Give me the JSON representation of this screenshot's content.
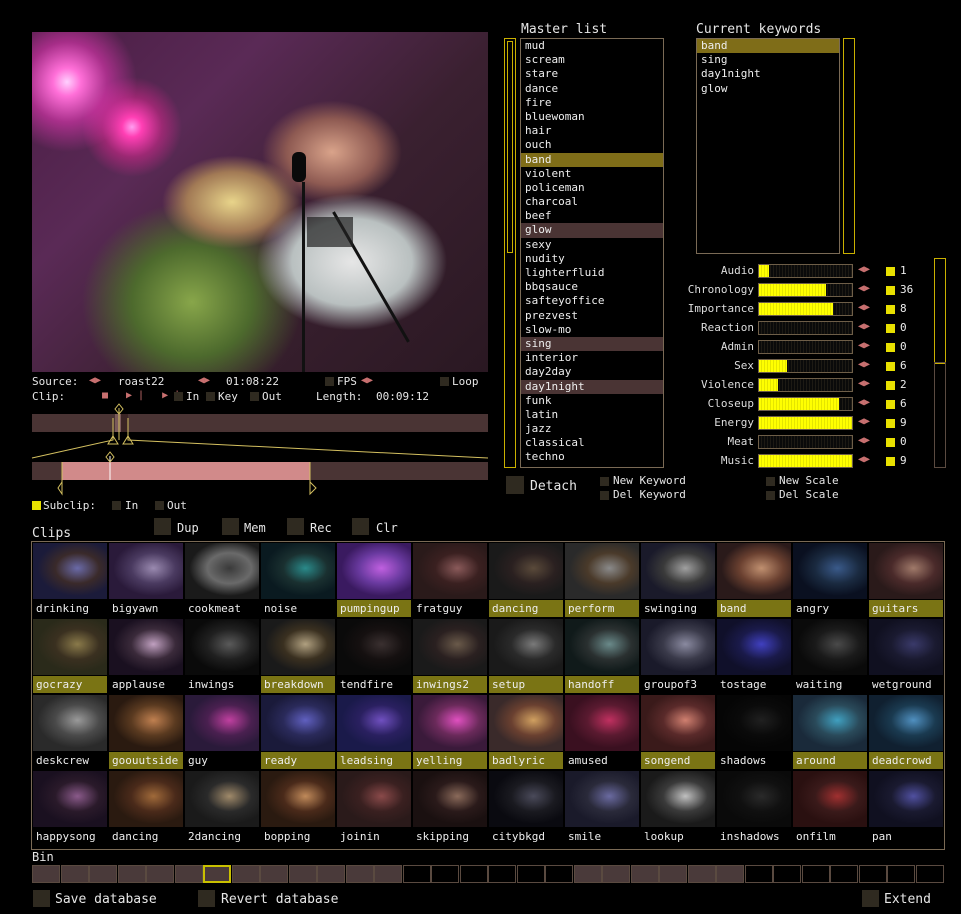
{
  "source": {
    "label": "Source:",
    "name": "roast22",
    "time": "01:08:22",
    "fps": "FPS",
    "loop": "Loop"
  },
  "clip": {
    "label": "Clip:",
    "in": "In",
    "key": "Key",
    "out": "Out",
    "length_label": "Length:",
    "length": "00:09:12"
  },
  "subclip": {
    "label": "Subclip:",
    "in": "In",
    "out": "Out"
  },
  "master": {
    "title": "Master list",
    "items": [
      "mud",
      "scream",
      "stare",
      "dance",
      "fire",
      "bluewoman",
      "hair",
      "ouch",
      "band",
      "violent",
      "policeman",
      "charcoal",
      "beef",
      "glow",
      "sexy",
      "nudity",
      "lighterfluid",
      "bbqsauce",
      "safteyoffice",
      "prezvest",
      "slow-mo",
      "sing",
      "interior",
      "day2day",
      "day1night",
      "funk",
      "latin",
      "jazz",
      "classical",
      "techno"
    ],
    "selected_primary": [
      "band"
    ],
    "selected_secondary": [
      "glow",
      "sing",
      "day1night"
    ]
  },
  "keywords": {
    "title": "Current keywords",
    "items": [
      "band",
      "sing",
      "day1night",
      "glow"
    ],
    "selected": "band"
  },
  "scales": [
    {
      "label": "Audio",
      "value": 1,
      "max": 9
    },
    {
      "label": "Chronology",
      "value": 36,
      "max": 50
    },
    {
      "label": "Importance",
      "value": 8,
      "max": 10
    },
    {
      "label": "Reaction",
      "value": 0,
      "max": 9
    },
    {
      "label": "Admin",
      "value": 0,
      "max": 9
    },
    {
      "label": "Sex",
      "value": 6,
      "max": 20
    },
    {
      "label": "Violence",
      "value": 2,
      "max": 10
    },
    {
      "label": "Closeup",
      "value": 6,
      "max": 7
    },
    {
      "label": "Energy",
      "value": 9,
      "max": 9
    },
    {
      "label": "Meat",
      "value": 0,
      "max": 9
    },
    {
      "label": "Music",
      "value": 9,
      "max": 9
    }
  ],
  "buttons": {
    "detach": "Detach",
    "new_keyword": "New Keyword",
    "del_keyword": "Del Keyword",
    "new_scale": "New Scale",
    "del_scale": "Del Scale",
    "dup": "Dup",
    "mem": "Mem",
    "rec": "Rec",
    "clr": "Clr",
    "save": "Save database",
    "revert": "Revert database",
    "extend": "Extend"
  },
  "clips_title": "Clips",
  "bin_title": "Bin",
  "clips": [
    {
      "name": "drinking",
      "hl": false,
      "c": [
        "#1b1b3a",
        "#6a6aa8",
        "#3a2a2a"
      ]
    },
    {
      "name": "bigyawn",
      "hl": false,
      "c": [
        "#2a1a3a",
        "#9a8ab0",
        "#4a3a60"
      ]
    },
    {
      "name": "cookmeat",
      "hl": false,
      "c": [
        "#1a1a1a",
        "#3a3a3a",
        "#6a6a6a"
      ]
    },
    {
      "name": "noise",
      "hl": false,
      "c": [
        "#0a1a20",
        "#2a8a8a",
        "#1a3030"
      ]
    },
    {
      "name": "pumpingup",
      "hl": true,
      "c": [
        "#3a1a60",
        "#c060e0",
        "#6a3aa0"
      ]
    },
    {
      "name": "fratguy",
      "hl": false,
      "c": [
        "#2a1a1a",
        "#8a5a5a",
        "#3a2020"
      ]
    },
    {
      "name": "dancing",
      "hl": true,
      "c": [
        "#1a1a1a",
        "#5a4a3a",
        "#2a2020"
      ]
    },
    {
      "name": "perform",
      "hl": true,
      "c": [
        "#2a2a2a",
        "#8a8a8a",
        "#4a3a2a"
      ]
    },
    {
      "name": "swinging",
      "hl": false,
      "c": [
        "#1a1a2a",
        "#a0a0a0",
        "#3a3a3a"
      ]
    },
    {
      "name": "band",
      "hl": true,
      "c": [
        "#2a1a1a",
        "#c09070",
        "#6a4030"
      ]
    },
    {
      "name": "angry",
      "hl": false,
      "c": [
        "#0a1020",
        "#3a5a8a",
        "#1a2a40"
      ]
    },
    {
      "name": "guitars",
      "hl": true,
      "c": [
        "#2a1a1a",
        "#a07a6a",
        "#4a2a2a"
      ]
    },
    {
      "name": "gocrazy",
      "hl": true,
      "c": [
        "#2a2a1a",
        "#8a7a4a",
        "#3a3020"
      ]
    },
    {
      "name": "applause",
      "hl": false,
      "c": [
        "#1a1020",
        "#c0a0c0",
        "#3a2a3a"
      ]
    },
    {
      "name": "inwings",
      "hl": false,
      "c": [
        "#0a0a0a",
        "#5a5a5a",
        "#202020"
      ]
    },
    {
      "name": "breakdown",
      "hl": true,
      "c": [
        "#1a1a1a",
        "#b0a080",
        "#3a3020"
      ]
    },
    {
      "name": "tendfire",
      "hl": false,
      "c": [
        "#0a0a0a",
        "#3a3030",
        "#151010"
      ]
    },
    {
      "name": "inwings2",
      "hl": true,
      "c": [
        "#1a1a1a",
        "#6a5a4a",
        "#2a2020"
      ]
    },
    {
      "name": "setup",
      "hl": true,
      "c": [
        "#1a1a1a",
        "#7a7a7a",
        "#2a2a2a"
      ]
    },
    {
      "name": "handoff",
      "hl": true,
      "c": [
        "#101a1a",
        "#6a8a8a",
        "#2a3030"
      ]
    },
    {
      "name": "groupof3",
      "hl": false,
      "c": [
        "#1a1a2a",
        "#8a8aa0",
        "#3a3a4a"
      ]
    },
    {
      "name": "tostage",
      "hl": false,
      "c": [
        "#10102a",
        "#4040c0",
        "#1a1a4a"
      ]
    },
    {
      "name": "waiting",
      "hl": false,
      "c": [
        "#0a0a0a",
        "#4a4a4a",
        "#1a1a1a"
      ]
    },
    {
      "name": "wetground",
      "hl": false,
      "c": [
        "#101020",
        "#3a3a6a",
        "#1a1a30"
      ]
    },
    {
      "name": "deskcrew",
      "hl": false,
      "c": [
        "#2a2a2a",
        "#9a9a9a",
        "#4a4a4a"
      ]
    },
    {
      "name": "goouutside",
      "hl": true,
      "c": [
        "#2a1a10",
        "#c08050",
        "#5a3a20"
      ]
    },
    {
      "name": "guy",
      "hl": false,
      "c": [
        "#2a1a3a",
        "#c040a0",
        "#4a2050"
      ]
    },
    {
      "name": "ready",
      "hl": true,
      "c": [
        "#1a1a3a",
        "#6060c0",
        "#2a2a5a"
      ]
    },
    {
      "name": "leadsing",
      "hl": true,
      "c": [
        "#1a1a4a",
        "#7050c0",
        "#2a2060"
      ]
    },
    {
      "name": "yelling",
      "hl": true,
      "c": [
        "#3a1a3a",
        "#e050c0",
        "#6a2a5a"
      ]
    },
    {
      "name": "badlyric",
      "hl": true,
      "c": [
        "#3a2a2a",
        "#d0a060",
        "#6a4030"
      ]
    },
    {
      "name": "amused",
      "hl": false,
      "c": [
        "#3a1020",
        "#c03060",
        "#5a1a30"
      ]
    },
    {
      "name": "songend",
      "hl": true,
      "c": [
        "#3a1a1a",
        "#d08070",
        "#5a2a2a"
      ]
    },
    {
      "name": "shadows",
      "hl": false,
      "c": [
        "#050505",
        "#202020",
        "#0a0a0a"
      ]
    },
    {
      "name": "around",
      "hl": true,
      "c": [
        "#1a2a3a",
        "#40a0c0",
        "#2a4a5a"
      ]
    },
    {
      "name": "deadcrowd",
      "hl": true,
      "c": [
        "#102030",
        "#5090c0",
        "#1a3a50"
      ]
    },
    {
      "name": "happysong",
      "hl": false,
      "c": [
        "#1a1020",
        "#8a5a8a",
        "#2a1a2a"
      ]
    },
    {
      "name": "dancing",
      "hl": false,
      "c": [
        "#2a1a10",
        "#a06a3a",
        "#4a2a1a"
      ]
    },
    {
      "name": "2dancing",
      "hl": false,
      "c": [
        "#1a1a1a",
        "#a08a6a",
        "#2a2a2a"
      ]
    },
    {
      "name": "bopping",
      "hl": false,
      "c": [
        "#2a1a10",
        "#c08a5a",
        "#4a2a1a"
      ]
    },
    {
      "name": "joinin",
      "hl": false,
      "c": [
        "#2a1a1a",
        "#8a4a4a",
        "#3a2020"
      ]
    },
    {
      "name": "skipping",
      "hl": false,
      "c": [
        "#1a1010",
        "#8a6a5a",
        "#2a1a1a"
      ]
    },
    {
      "name": "citybkgd",
      "hl": false,
      "c": [
        "#0a0a10",
        "#4a4a5a",
        "#1a1a20"
      ]
    },
    {
      "name": "smile",
      "hl": false,
      "c": [
        "#1a1a2a",
        "#6a6aa0",
        "#2a2a3a"
      ]
    },
    {
      "name": "lookup",
      "hl": false,
      "c": [
        "#1a1a1a",
        "#c0c0c0",
        "#3a3a3a"
      ]
    },
    {
      "name": "inshadows",
      "hl": false,
      "c": [
        "#0a0a0a",
        "#2a2a2a",
        "#101010"
      ]
    },
    {
      "name": "onfilm",
      "hl": false,
      "c": [
        "#2a1010",
        "#a03030",
        "#3a1a1a"
      ]
    },
    {
      "name": "pan",
      "hl": false,
      "c": [
        "#101020",
        "#5050a0",
        "#1a1a30"
      ]
    }
  ],
  "bin": {
    "filled": 23,
    "selected": 6,
    "empty_from": 13,
    "empty_to": 18,
    "total": 32,
    "empty_tail_from": 25
  }
}
